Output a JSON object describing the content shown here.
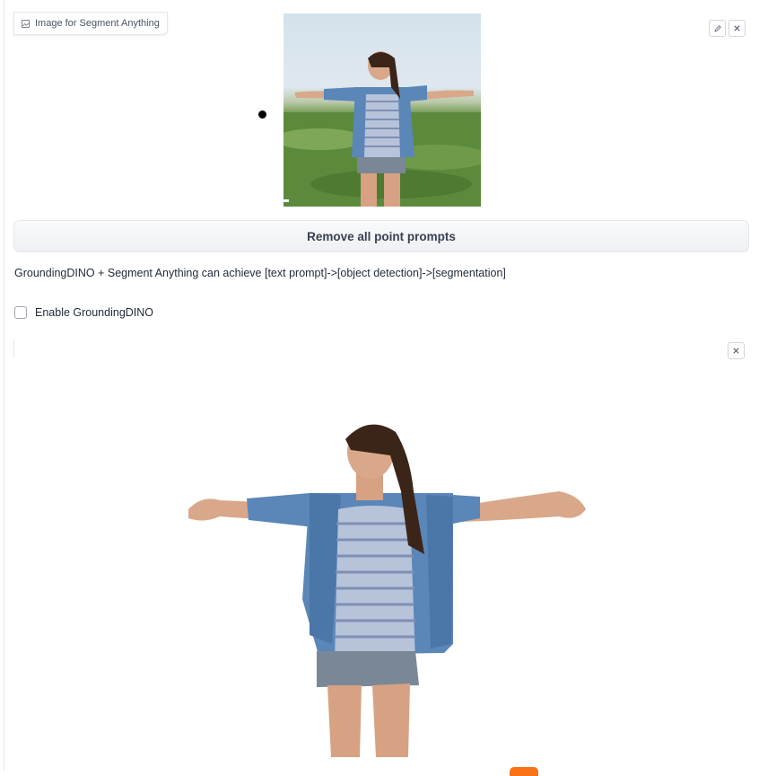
{
  "image_input": {
    "label": "Image for Segment Anything",
    "icons": [
      "image-icon",
      "edit-icon",
      "close-icon"
    ]
  },
  "buttons": {
    "remove_points": "Remove all point prompts"
  },
  "info": {
    "description": "GroundingDINO + Segment Anything can achieve [text prompt]->[object detection]->[segmentation]"
  },
  "grounding": {
    "enable_label": "Enable GroundingDINO",
    "checked": false
  },
  "output_image": {
    "icons": [
      "close-icon"
    ]
  },
  "colors": {
    "accent": "#f97316",
    "border": "#e5e7eb",
    "text": "#1f2937"
  }
}
